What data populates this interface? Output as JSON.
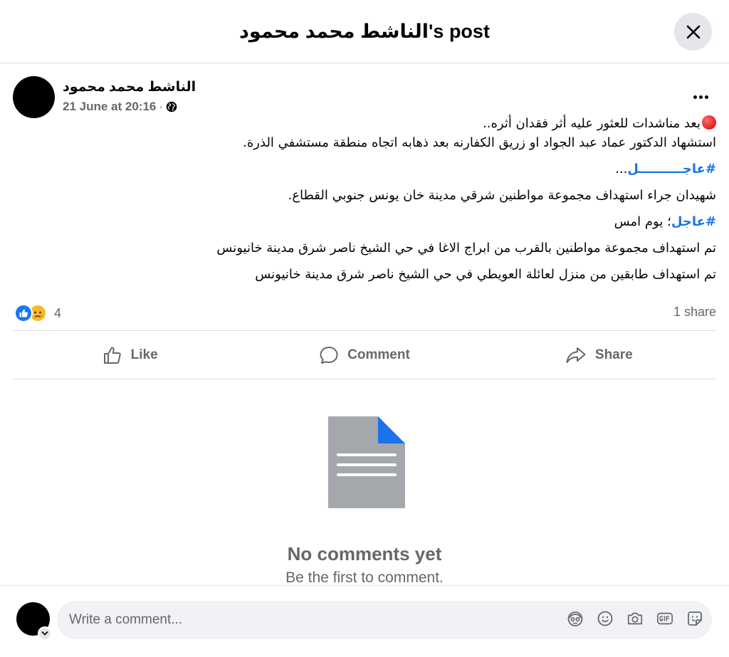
{
  "header": {
    "title": "الناشط محمد محمود's post"
  },
  "post": {
    "author": "الناشط محمد محمود",
    "date": "21 June at 20:16",
    "separator": "·",
    "lines": {
      "l1": "بعد مناشدات للعثور عليه أثر فقدان أثره..",
      "l2": "استشهاد الدكتور عماد عبد الجواد او زريق الكفارنه بعد ذهابه اتجاه منطقة مستشفي الذرة.",
      "l3_tag": "#عاجــــــــــل",
      "l3_rest": "...",
      "l4": "شهيدان جراء استهداف مجموعة مواطنين شرقي مدينة خان يونس جنوبي القطاع.",
      "l5_tag": "#عاجل",
      "l5_rest": "؛ يوم امس",
      "l6": "تم استهداف مجموعة مواطنين بالقرب من ابراج الاغا في حي الشيخ ناصر شرق مدينة خانيونس",
      "l7": "تم استهداف طابقين من منزل لعائلة العويطي في حي الشيخ ناصر شرق مدينة خانيونس"
    },
    "reaction_count": "4",
    "share_count": "1 share"
  },
  "actions": {
    "like": "Like",
    "comment": "Comment",
    "share": "Share"
  },
  "empty": {
    "title": "No comments yet",
    "subtitle": "Be the first to comment."
  },
  "composer": {
    "placeholder": "Write a comment..."
  },
  "colors": {
    "accent": "#1877f2",
    "hashtag": "#1b74e4",
    "muted": "#65676b",
    "doc_gray": "#a4a7ab",
    "doc_corner": "#1a73e8"
  },
  "icons": [
    "close-icon",
    "globe-icon",
    "more-icon",
    "like-reaction-icon",
    "sad-reaction-icon",
    "like-icon",
    "comment-icon",
    "share-icon",
    "document-icon",
    "avatar-sticker-icon",
    "emoji-icon",
    "camera-icon",
    "gif-icon",
    "sticker-icon",
    "chevron-down-icon"
  ]
}
